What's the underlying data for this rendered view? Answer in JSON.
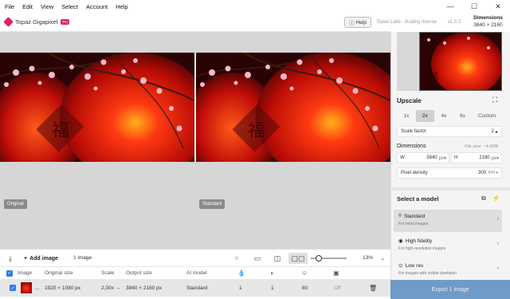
{
  "menu": [
    "File",
    "Edit",
    "View",
    "Select",
    "Account",
    "Help"
  ],
  "window_controls": {
    "minimize": "—",
    "maximize": "☐",
    "close": "✕"
  },
  "app": {
    "name": "Topaz Gigapixel",
    "badge": "Pro",
    "help_label": "Help",
    "license": "Topaz Labs - floating license",
    "version": "v1.0.2"
  },
  "dimensions_header": {
    "title": "Dimensions",
    "value": "3840 × 2160"
  },
  "preview": {
    "left_label": "Original",
    "right_label": "Standard"
  },
  "toolbar": {
    "add_image": "Add image",
    "image_count": "1 image",
    "zoom": "13%"
  },
  "table": {
    "headers": [
      "Image",
      "Original size",
      "Scale",
      "Output size",
      "AI model"
    ],
    "row": {
      "name": "...",
      "original_size": "1920 × 1080 px",
      "scale": "2,00x →",
      "output_size": "3840 × 2160 px",
      "model": "Standard",
      "v1": "1",
      "v2": "1",
      "v3": "80",
      "status": "Off"
    }
  },
  "upscale": {
    "title": "Upscale",
    "scales": [
      "1x",
      "2x",
      "4x",
      "6x",
      "Custom"
    ],
    "selected_scale": "2x",
    "scale_factor_label": "Scale factor",
    "scale_factor_value": "2",
    "dimensions_label": "Dimensions",
    "file_size": "File size: ~4.8MB",
    "width_label": "W",
    "width_value": "3840",
    "width_unit": "px▾",
    "height_label": "H",
    "height_value": "2160",
    "height_unit": "px▾",
    "density_label": "Pixel density",
    "density_value": "300",
    "density_unit": "PPI ▾"
  },
  "models": {
    "title": "Select a model",
    "items": [
      {
        "name": "Standard",
        "desc": "For most images",
        "icon": "⌾"
      },
      {
        "name": "High fidelity",
        "desc": "For high-resolution images",
        "icon": "◉"
      },
      {
        "name": "Low res",
        "desc": "For images with visible pixelation",
        "icon": "⊙"
      }
    ]
  },
  "export_label": "Export 1 image",
  "colors": {
    "accent": "#2f7ce0",
    "brand": "#e0245e",
    "export": "#6f9bc9"
  }
}
